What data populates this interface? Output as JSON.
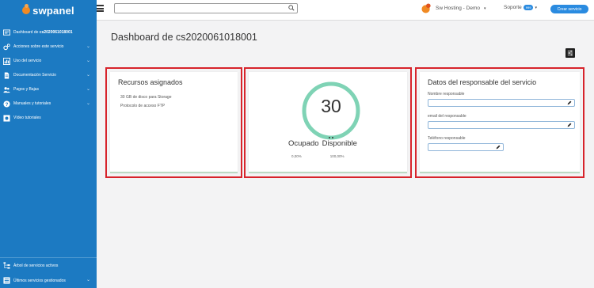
{
  "brand": {
    "name": "swpanel",
    "accent": "#f08a24",
    "sidebar_bg": "#1c7ac2"
  },
  "topbar": {
    "search_value": "",
    "search_placeholder": "",
    "company": "Sw Hosting - Demo",
    "support": "Soporte",
    "support_badge": "999",
    "create_button": "Crear servicio"
  },
  "sidebar": {
    "items": [
      {
        "label_prefix": "Dashboard de ",
        "label_bold": "cs2020061018001",
        "icon": "dashboard-icon",
        "chevron": false
      },
      {
        "label": "Acciones sobre este servicio",
        "icon": "gears-icon",
        "chevron": true
      },
      {
        "label": "Uso del servicio",
        "icon": "chart-icon",
        "chevron": true
      },
      {
        "label": "Documentación Servicio",
        "icon": "document-icon",
        "chevron": true
      },
      {
        "label": "Pagos y Bajas",
        "icon": "users-icon",
        "chevron": true
      },
      {
        "label": "Manuales y tutoriales",
        "icon": "help-icon",
        "chevron": true
      },
      {
        "label": "Vídeo tutoriales",
        "icon": "video-icon",
        "chevron": false
      }
    ],
    "bottom_items": [
      {
        "label": "Árbol de servicios activos",
        "icon": "tree-icon",
        "chevron": false
      },
      {
        "label": "Últimos servicios gestionados",
        "icon": "list-icon",
        "chevron": true
      }
    ]
  },
  "main": {
    "title": "Dashboard de cs2020061018001",
    "resources": {
      "title": "Recursos asignados",
      "lines": [
        "30 GB de disco para Storage",
        "Protocolo de acceso FTP"
      ]
    },
    "usage": {
      "value": "30",
      "occupied_label": "Ocupado",
      "available_label": "Disponible",
      "occupied_pct": "0,00%",
      "available_pct": "100,00%",
      "occupied_fraction": 0.0,
      "gauge_color": "#7fd3b5"
    },
    "responsible": {
      "title": "Datos del responsable del servicio",
      "fields": [
        {
          "label": "Nombre responsable",
          "value": ""
        },
        {
          "label": "email del responsable",
          "value": ""
        },
        {
          "label": "Teléfono responsable",
          "value": ""
        }
      ]
    }
  }
}
